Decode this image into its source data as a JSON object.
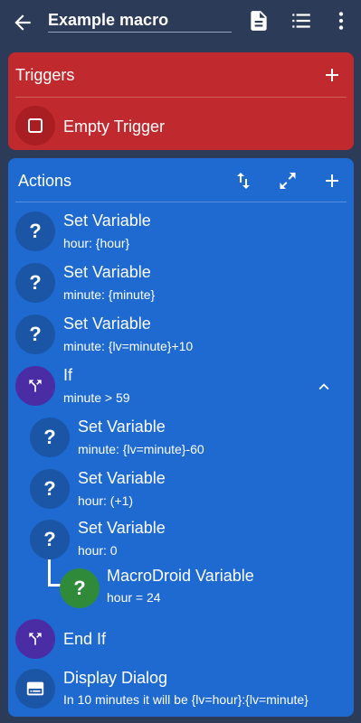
{
  "header": {
    "title": "Example macro",
    "icons": [
      "back-arrow-icon",
      "document-icon",
      "list-icon",
      "more-vertical-icon"
    ]
  },
  "triggers": {
    "title": "Triggers",
    "items": [
      {
        "label": "Empty Trigger",
        "icon": "empty-square-icon"
      }
    ]
  },
  "actions": {
    "title": "Actions",
    "items": [
      {
        "title": "Set Variable",
        "sub": "hour: {hour}",
        "icon": "question-icon"
      },
      {
        "title": "Set Variable",
        "sub": "minute: {minute}",
        "icon": "question-icon"
      },
      {
        "title": "Set Variable",
        "sub": "minute: {lv=minute}+10",
        "icon": "question-icon"
      },
      {
        "title": "If",
        "sub": "minute > 59",
        "icon": "branch-icon"
      },
      {
        "title": "Set Variable",
        "sub": "minute: {lv=minute}-60",
        "icon": "question-icon"
      },
      {
        "title": "Set Variable",
        "sub": "hour: (+1)",
        "icon": "question-icon"
      },
      {
        "title": "Set Variable",
        "sub": "hour: 0",
        "icon": "question-icon"
      },
      {
        "title": "MacroDroid Variable",
        "sub": "hour = 24",
        "icon": "question-icon"
      },
      {
        "title": "End If",
        "sub": "",
        "icon": "branch-icon"
      },
      {
        "title": "Display Dialog",
        "sub": "In 10 minutes it will be {lv=hour}:{lv=minute}",
        "icon": "dialog-icon"
      }
    ]
  },
  "colors": {
    "topbar": "#2b3b58",
    "triggers": "#c0292d",
    "actions": "#1e6ad0",
    "purple": "#4a2ca4",
    "green": "#2f8a3a"
  }
}
